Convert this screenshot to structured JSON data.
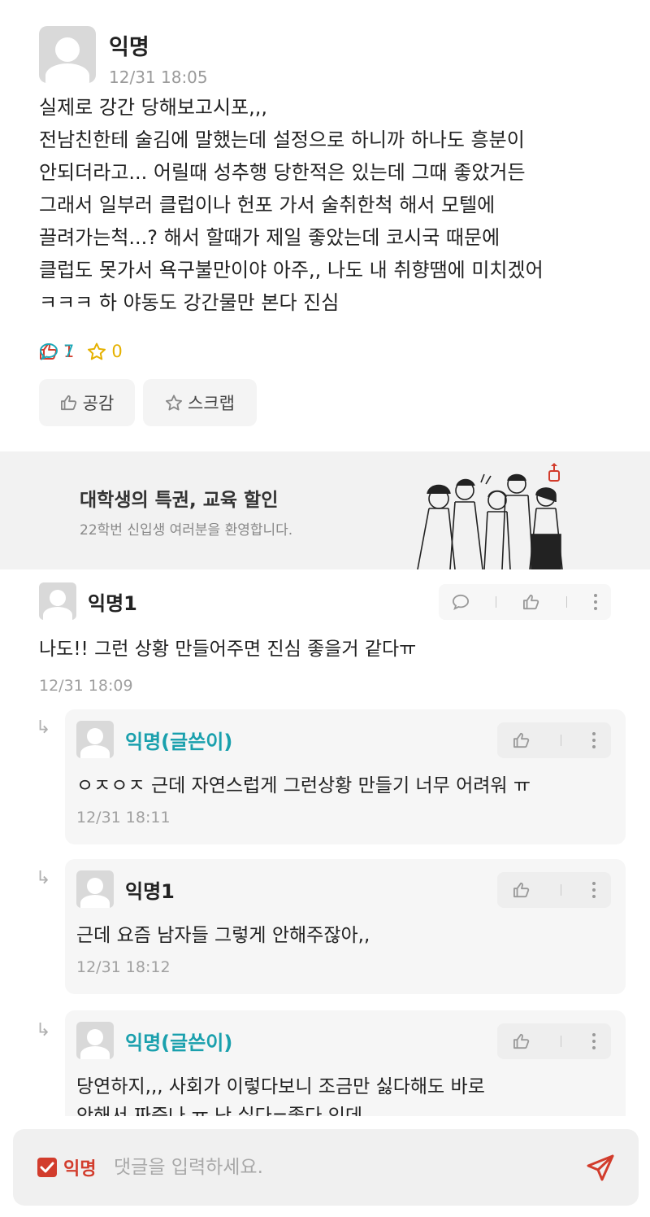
{
  "post": {
    "author": "익명",
    "time": "12/31 18:05",
    "body_lines": [
      "실제로 강간 당해보고시포,,,",
      "전남친한테 술김에 말했는데 설정으로 하니까 하나도 흥분이",
      "안되더라고... 어릴때 성추행 당한적은 있는데 그때 좋았거든",
      "그래서 일부러 클럽이나 헌포 가서 술취한척 해서 모텔에",
      "끌려가는척...? 해서 할때가 제일 좋았는데 코시국 때문에",
      "클럽도 못가서 욕구불만이야 아주,, 나도 내 취향땜에 미치겠어",
      "ㅋㅋㅋ 하 야동도 강간물만 본다 진심"
    ],
    "stats": {
      "likes": "1",
      "comments": "7",
      "scraps": "0"
    },
    "like_button": "공감",
    "scrap_button": "스크랩"
  },
  "ad": {
    "title": "대학생의 특권, 교육 할인",
    "subtitle": "22학번 신입생 여러분을 환영합니다."
  },
  "comments": [
    {
      "author": "익명1",
      "text": "나도!! 그런 상황 만들어주면 진심 좋을거 같다ㅠ",
      "time": "12/31 18:09"
    }
  ],
  "replies": [
    {
      "author": "익명(글쓴이)",
      "text": "ㅇㅈㅇㅈ 근데 자연스럽게 그런상황 만들기 너무 어려워 ㅠ",
      "time": "12/31 18:11",
      "op": true
    },
    {
      "author": "익명1",
      "text": "근데 요즘 남자들 그렇게 안해주잖아,,",
      "time": "12/31 18:12",
      "op": false
    },
    {
      "author": "익명(글쓴이)",
      "text": "당연하지,,, 사회가 이렇다보니 조금만 싫다해도 바로",
      "text2": "안해서 짜증나 ㅠ 난 싫다=좋다 인데",
      "op": true
    }
  ],
  "input": {
    "anon_label": "익명",
    "placeholder": "댓글을 입력하세요."
  },
  "colors": {
    "accent_red": "#d23c2c",
    "op_teal": "#1aa0ad",
    "star_yellow": "#e5b100"
  }
}
